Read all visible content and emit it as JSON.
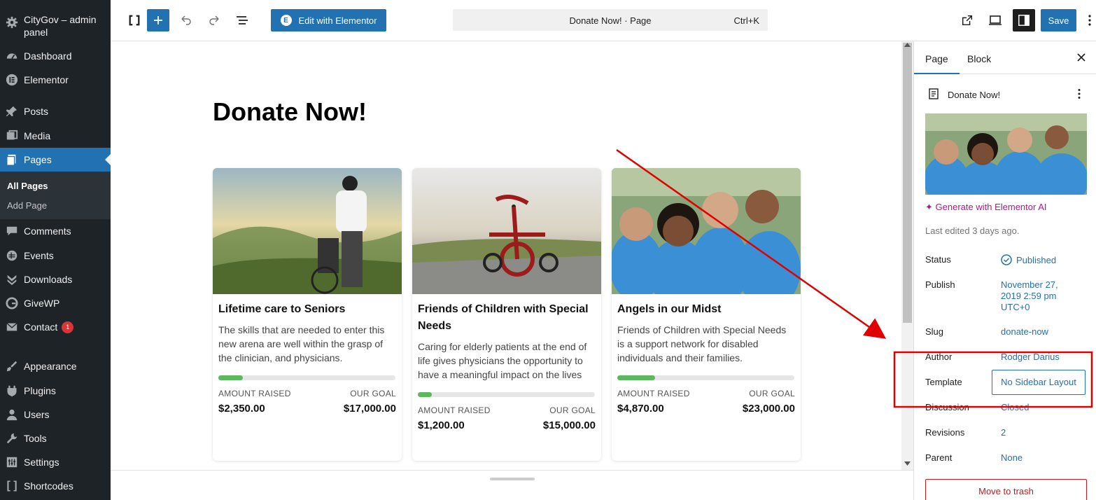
{
  "admin": {
    "site_title": "CityGov – admin panel",
    "menu": [
      {
        "label": "Dashboard",
        "icon": "dashboard-icon"
      },
      {
        "label": "Elementor",
        "icon": "elementor-icon"
      },
      {
        "label": "Posts",
        "icon": "pin-icon"
      },
      {
        "label": "Media",
        "icon": "media-icon"
      },
      {
        "label": "Pages",
        "icon": "pages-icon"
      },
      {
        "label": "Comments",
        "icon": "comment-icon"
      },
      {
        "label": "Events",
        "icon": "calendar-icon"
      },
      {
        "label": "Downloads",
        "icon": "download-icon"
      },
      {
        "label": "GiveWP",
        "icon": "givewp-icon"
      },
      {
        "label": "Contact",
        "icon": "mail-icon",
        "badge": "1"
      },
      {
        "label": "Appearance",
        "icon": "brush-icon"
      },
      {
        "label": "Plugins",
        "icon": "plugin-icon"
      },
      {
        "label": "Users",
        "icon": "user-icon"
      },
      {
        "label": "Tools",
        "icon": "wrench-icon"
      },
      {
        "label": "Settings",
        "icon": "settings-icon"
      },
      {
        "label": "Shortcodes",
        "icon": "shortcode-icon"
      }
    ],
    "submenu": {
      "all_pages": "All Pages",
      "add_page": "Add Page"
    }
  },
  "toolbar": {
    "edit_elementor": "Edit with Elementor",
    "command_title": "Donate Now! · Page",
    "shortcut": "Ctrl+K",
    "save": "Save"
  },
  "canvas": {
    "page_title": "Donate Now!",
    "cards": [
      {
        "title": "Lifetime care to Seniors",
        "desc": "The skills that are needed to enter this new arena are well within the grasp of the clinician, and physicians.",
        "amount_label": "AMOUNT RAISED",
        "goal_label": "OUR GOAL",
        "amount": "$2,350.00",
        "goal": "$17,000.00",
        "progress": 0.138
      },
      {
        "title": "Friends of Children with Special Needs",
        "desc": "Caring for elderly patients at the end of life gives physicians the opportunity to have a meaningful impact on the lives",
        "amount_label": "AMOUNT RAISED",
        "goal_label": "OUR GOAL",
        "amount": "$1,200.00",
        "goal": "$15,000.00",
        "progress": 0.08
      },
      {
        "title": "Angels in our Midst",
        "desc": "Friends of Children with Special Needs is a support network for disabled individuals and their families.",
        "amount_label": "AMOUNT RAISED",
        "goal_label": "OUR GOAL",
        "amount": "$4,870.00",
        "goal": "$23,000.00",
        "progress": 0.212
      }
    ]
  },
  "settings": {
    "tab_page": "Page",
    "tab_block": "Block",
    "doc_title": "Donate Now!",
    "generate_ai": "Generate with Elementor AI",
    "last_edited": "Last edited 3 days ago.",
    "status_label": "Status",
    "status_value": "Published",
    "publish_label": "Publish",
    "publish_value": "November 27, 2019 2:59 pm UTC+0",
    "slug_label": "Slug",
    "slug_value": "donate-now",
    "author_label": "Author",
    "author_value": "Rodger Darius",
    "template_label": "Template",
    "template_value": "No Sidebar Layout",
    "discussion_label": "Discussion",
    "discussion_value": "Closed",
    "revisions_label": "Revisions",
    "revisions_value": "2",
    "parent_label": "Parent",
    "parent_value": "None",
    "trash": "Move to trash"
  },
  "colors": {
    "accent": "#2271b1",
    "admin_bg": "#1d2327",
    "annotation": "#e00000",
    "progress": "#5cb85c"
  }
}
